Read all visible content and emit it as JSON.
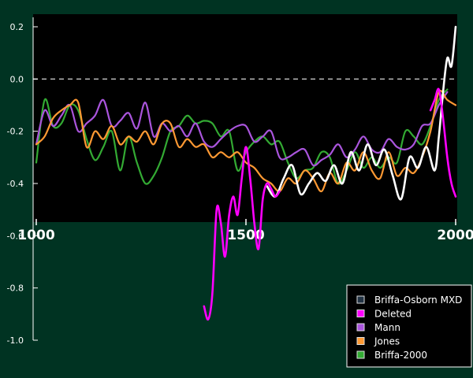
{
  "chart_data": {
    "type": "line",
    "title": "",
    "xlabel": "",
    "ylabel": "",
    "xlim": [
      1000,
      2000
    ],
    "ylim": [
      -1.0,
      0.2
    ],
    "y_ticks": [
      0.2,
      0.0,
      -0.2,
      -0.4,
      -0.6,
      -0.8,
      -1.0
    ],
    "y_tick_labels": [
      "0.2",
      "0.0",
      "-0.2",
      "-0.4",
      "-0.6",
      "-0.8",
      "-1.0"
    ],
    "x_ticks": [
      1000,
      1500,
      2000
    ],
    "x_tick_labels": [
      "1000",
      "1500",
      "2000"
    ],
    "zero_line": 0.0,
    "grid": false,
    "legend_position": "bottom-right",
    "series": [
      {
        "name": "Briffa-Osborn MXD",
        "color": "#ffffff",
        "x": [
          1550,
          1570,
          1590,
          1610,
          1630,
          1650,
          1670,
          1690,
          1710,
          1730,
          1750,
          1770,
          1790,
          1810,
          1830,
          1850,
          1870,
          1890,
          1910,
          1930,
          1950,
          1960,
          1970,
          1980,
          1990,
          2000
        ],
        "y": [
          -0.41,
          -0.45,
          -0.38,
          -0.33,
          -0.44,
          -0.4,
          -0.36,
          -0.39,
          -0.33,
          -0.4,
          -0.28,
          -0.35,
          -0.25,
          -0.33,
          -0.27,
          -0.37,
          -0.46,
          -0.3,
          -0.34,
          -0.26,
          -0.35,
          -0.22,
          -0.05,
          0.08,
          0.05,
          0.2
        ]
      },
      {
        "name": "Deleted",
        "color": "#ff00ff",
        "x": [
          1400,
          1410,
          1420,
          1430,
          1440,
          1450,
          1460,
          1470,
          1480,
          1490,
          1500,
          1510,
          1520,
          1530,
          1540,
          1550,
          1560,
          1570,
          1580,
          1940,
          1950,
          1960,
          1970,
          1980,
          1990,
          2000
        ],
        "y": [
          -0.87,
          -0.92,
          -0.82,
          -0.5,
          -0.55,
          -0.68,
          -0.52,
          -0.45,
          -0.52,
          -0.38,
          -0.26,
          -0.38,
          -0.55,
          -0.65,
          -0.46,
          -0.4,
          -0.42,
          -0.45,
          -0.43,
          -0.12,
          -0.08,
          -0.04,
          -0.15,
          -0.3,
          -0.4,
          -0.45
        ]
      },
      {
        "name": "Mann",
        "color": "#aa55dd",
        "x": [
          1000,
          1020,
          1040,
          1060,
          1080,
          1100,
          1120,
          1140,
          1160,
          1180,
          1200,
          1220,
          1240,
          1260,
          1280,
          1300,
          1320,
          1340,
          1360,
          1380,
          1400,
          1420,
          1440,
          1460,
          1480,
          1500,
          1520,
          1540,
          1560,
          1580,
          1600,
          1620,
          1640,
          1660,
          1680,
          1700,
          1720,
          1740,
          1760,
          1780,
          1800,
          1820,
          1840,
          1860,
          1880,
          1900,
          1920,
          1940,
          1960,
          1980
        ],
        "y": [
          -0.25,
          -0.12,
          -0.18,
          -0.14,
          -0.1,
          -0.2,
          -0.17,
          -0.14,
          -0.08,
          -0.18,
          -0.16,
          -0.13,
          -0.19,
          -0.09,
          -0.22,
          -0.17,
          -0.2,
          -0.18,
          -0.22,
          -0.17,
          -0.24,
          -0.26,
          -0.23,
          -0.2,
          -0.18,
          -0.18,
          -0.24,
          -0.22,
          -0.2,
          -0.3,
          -0.3,
          -0.28,
          -0.27,
          -0.33,
          -0.31,
          -0.29,
          -0.25,
          -0.3,
          -0.27,
          -0.22,
          -0.27,
          -0.28,
          -0.23,
          -0.26,
          -0.27,
          -0.25,
          -0.18,
          -0.17,
          -0.1,
          -0.05
        ]
      },
      {
        "name": "Jones",
        "color": "#ff9933",
        "x": [
          1000,
          1020,
          1040,
          1060,
          1080,
          1100,
          1120,
          1140,
          1160,
          1180,
          1200,
          1220,
          1240,
          1260,
          1280,
          1300,
          1320,
          1340,
          1360,
          1380,
          1400,
          1420,
          1440,
          1460,
          1480,
          1500,
          1520,
          1540,
          1560,
          1580,
          1600,
          1620,
          1640,
          1660,
          1680,
          1700,
          1720,
          1740,
          1760,
          1780,
          1800,
          1820,
          1840,
          1860,
          1880,
          1900,
          1920,
          1940,
          1960,
          1980,
          2000
        ],
        "y": [
          -0.25,
          -0.22,
          -0.15,
          -0.12,
          -0.1,
          -0.09,
          -0.26,
          -0.2,
          -0.23,
          -0.18,
          -0.25,
          -0.22,
          -0.24,
          -0.2,
          -0.25,
          -0.17,
          -0.17,
          -0.26,
          -0.23,
          -0.26,
          -0.25,
          -0.3,
          -0.28,
          -0.3,
          -0.28,
          -0.32,
          -0.34,
          -0.38,
          -0.4,
          -0.43,
          -0.38,
          -0.4,
          -0.35,
          -0.38,
          -0.43,
          -0.36,
          -0.4,
          -0.32,
          -0.35,
          -0.28,
          -0.35,
          -0.38,
          -0.28,
          -0.37,
          -0.34,
          -0.36,
          -0.3,
          -0.2,
          -0.05,
          -0.08,
          -0.1
        ]
      },
      {
        "name": "Briffa-2000",
        "color": "#33aa33",
        "x": [
          1000,
          1020,
          1040,
          1060,
          1080,
          1100,
          1120,
          1140,
          1160,
          1180,
          1200,
          1220,
          1240,
          1260,
          1280,
          1300,
          1320,
          1340,
          1360,
          1380,
          1400,
          1420,
          1440,
          1460,
          1480,
          1500,
          1520,
          1540,
          1560,
          1580,
          1600,
          1620,
          1640,
          1660,
          1680,
          1700,
          1720,
          1740,
          1760,
          1780,
          1800,
          1820,
          1840,
          1860,
          1880,
          1900,
          1920,
          1940,
          1960,
          1980
        ],
        "y": [
          -0.32,
          -0.08,
          -0.18,
          -0.17,
          -0.1,
          -0.12,
          -0.23,
          -0.31,
          -0.26,
          -0.2,
          -0.35,
          -0.22,
          -0.32,
          -0.4,
          -0.37,
          -0.3,
          -0.2,
          -0.18,
          -0.14,
          -0.17,
          -0.16,
          -0.17,
          -0.22,
          -0.2,
          -0.35,
          -0.28,
          -0.24,
          -0.22,
          -0.25,
          -0.24,
          -0.32,
          -0.38,
          -0.35,
          -0.34,
          -0.28,
          -0.3,
          -0.4,
          -0.35,
          -0.28,
          -0.34,
          -0.3,
          -0.34,
          -0.3,
          -0.32,
          -0.2,
          -0.22,
          -0.25,
          -0.18,
          -0.08,
          -0.04
        ]
      }
    ]
  }
}
